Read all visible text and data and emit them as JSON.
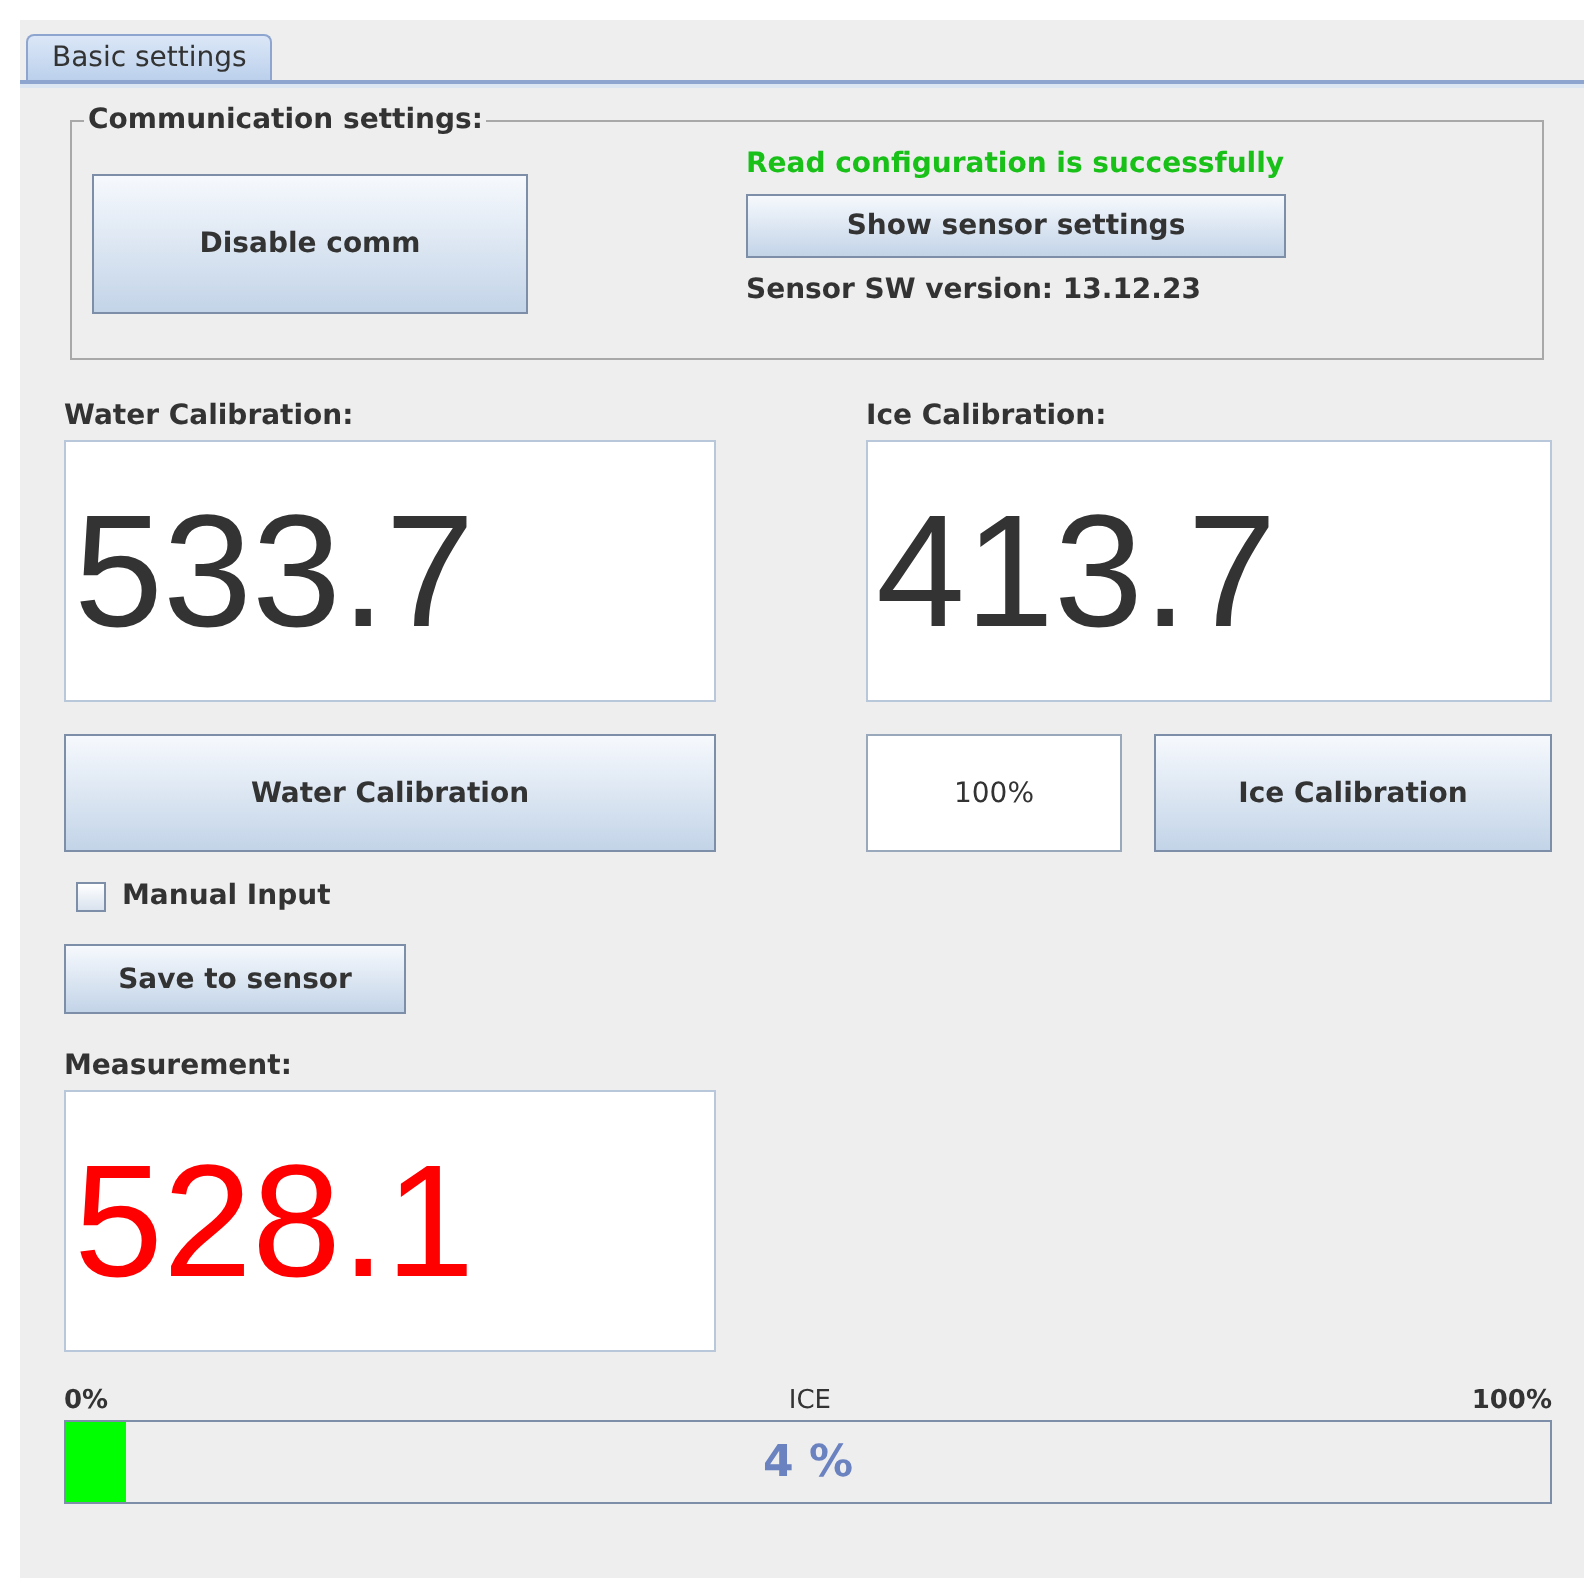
{
  "tabs": [
    {
      "label": "Basic settings",
      "selected": true
    }
  ],
  "communication": {
    "title": "Communication settings:",
    "disable_button": "Disable comm",
    "status": "Read configuration is successfully",
    "show_button": "Show sensor settings",
    "version": "Sensor SW version: 13.12.23"
  },
  "water": {
    "label": "Water Calibration:",
    "value": "533.7",
    "button": "Water Calibration"
  },
  "ice": {
    "label": "Ice Calibration:",
    "value": "413.7",
    "percent": "100%",
    "button": "Ice Calibration"
  },
  "manual_input": {
    "label": "Manual Input",
    "checked": false
  },
  "save_button": "Save to sensor",
  "measurement": {
    "label": "Measurement:",
    "value": "528.1"
  },
  "progress": {
    "min_label": "0%",
    "title": "ICE",
    "max_label": "100%",
    "level": 0.04,
    "reading": "4 %"
  }
}
